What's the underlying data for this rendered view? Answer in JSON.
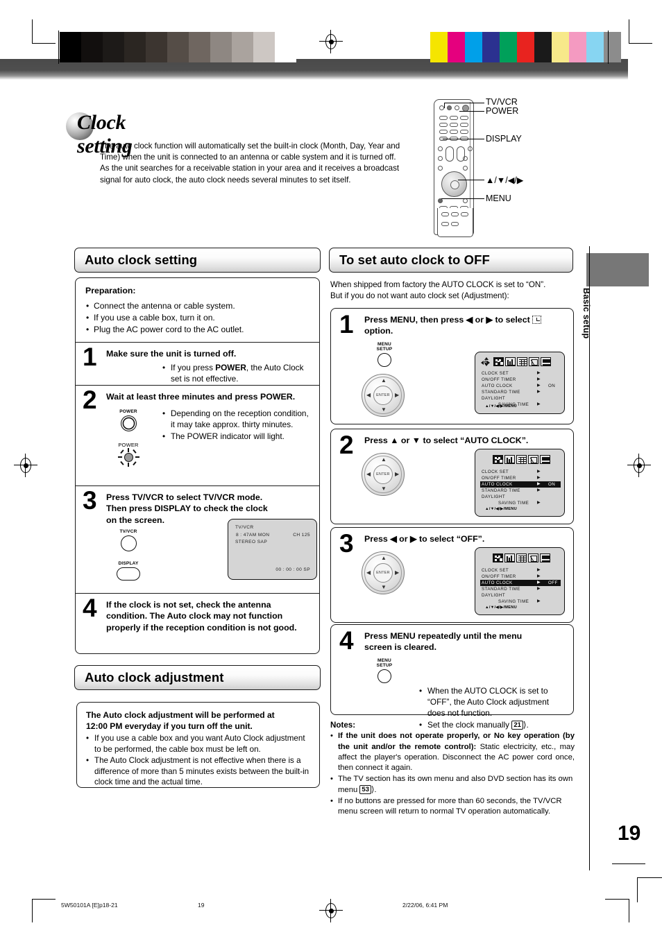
{
  "document": {
    "page_number": "19",
    "side_tab": "Basic setup",
    "title": "Clock setting",
    "intro": "The auto clock function will automatically set the built-in clock (Month, Day, Year and Time) when the unit  is connected to an antenna or cable system and it is turned off. As the unit searches for a receivable station in your area and it receives a broadcast signal for auto clock, the auto clock needs several minutes to set itself."
  },
  "remote_callouts": [
    {
      "label": "TV/VCR"
    },
    {
      "label": "POWER"
    },
    {
      "label": "DISPLAY"
    },
    {
      "label": "▲/▼/◀/▶"
    },
    {
      "label": "MENU"
    }
  ],
  "left_column": {
    "section1_header": "Auto clock setting",
    "preparation": {
      "heading": "Preparation:",
      "items": [
        "Connect the antenna or cable system.",
        "If you use a cable box, turn it on.",
        "Plug the AC power cord to the AC outlet."
      ]
    },
    "steps": [
      {
        "num": "1",
        "title": "Make sure the unit is turned off.",
        "bullets": [
          "If you press POWER, the Auto Clock set is not effective."
        ]
      },
      {
        "num": "2",
        "title": "Wait at least three minutes and press POWER.",
        "bullets": [
          "Depending on the reception condition, it may take approx. thirty minutes.",
          "The POWER indicator will light."
        ],
        "button_caption": "POWER",
        "indicator_caption": "POWER"
      },
      {
        "num": "3",
        "title": "Press TV/VCR to select TV/VCR mode. Then press DISPLAY to check the clock on the screen.",
        "bullets": [],
        "button_caption_1": "TV/VCR",
        "button_caption_2": "DISPLAY",
        "tv_screen": {
          "line1": "TV/VCR",
          "line2_left": "8 : 47AM  MON",
          "line2_right": "CH  125",
          "line3": "STEREO  SAP",
          "line4": "00 : 00 : 00   SP"
        }
      },
      {
        "num": "4",
        "title": "If the clock is not set, check the antenna condition. The Auto clock may not function properly if the reception condition is not good.",
        "bullets": []
      }
    ],
    "section2_header": "Auto clock adjustment",
    "adjustment": {
      "heading_line1": "The Auto clock adjustment will be performed at",
      "heading_line2": "12:00 PM everyday if you turn off the unit.",
      "items": [
        "If you use a cable box and you want Auto Clock adjustment to be performed, the cable box must be left on.",
        "The Auto Clock adjustment is not effective when there is a difference of more than 5 minutes exists between the built-in clock time and the actual time."
      ]
    }
  },
  "right_column": {
    "section_header": "To set auto clock to OFF",
    "intro_line1": "When shipped from factory the AUTO CLOCK is set to “ON”.",
    "intro_line2": "But if you do not want auto clock set (Adjustment):",
    "steps": [
      {
        "num": "1",
        "title_part1": "Press MENU, then press ◀ or ▶ to select",
        "title_part2": "option.",
        "button_caption_line1": "MENU",
        "button_caption_line2": "SETUP"
      },
      {
        "num": "2",
        "title": "Press ▲ or ▼ to select “AUTO CLOCK”."
      },
      {
        "num": "3",
        "title": "Press ◀ or ▶ to select “OFF”."
      },
      {
        "num": "4",
        "title": "Press MENU repeatedly until the menu screen is cleared.",
        "bullets": [
          "When the AUTO CLOCK is set to “OFF”, the Auto Clock adjustment does not function.",
          "Set the clock manually"
        ],
        "page_ref": "21",
        "button_caption_line1": "MENU",
        "button_caption_line2": "SETUP"
      }
    ],
    "osd_screens": [
      {
        "rows": [
          {
            "label": "CLOCK  SET",
            "arrow": "▶",
            "value": "",
            "highlight": false
          },
          {
            "label": "ON/OFF  TIMER",
            "arrow": "▶",
            "value": "",
            "highlight": false
          },
          {
            "label": "AUTO  CLOCK",
            "arrow": "▶",
            "value": "ON",
            "highlight": false
          },
          {
            "label": "STANDARD  TIME",
            "arrow": "▶",
            "value": "",
            "highlight": false
          },
          {
            "label": "DAYLIGHT",
            "arrow": "",
            "value": "",
            "highlight": false
          },
          {
            "label": "SAVING  TIME",
            "arrow": "▶",
            "value": "",
            "highlight": false,
            "indent": true
          }
        ],
        "footer": "▲/▼/◀/▶/MENU",
        "show_nav_icon": true
      },
      {
        "rows": [
          {
            "label": "CLOCK  SET",
            "arrow": "▶",
            "value": "",
            "highlight": false
          },
          {
            "label": "ON/OFF  TIMER",
            "arrow": "▶",
            "value": "",
            "highlight": false
          },
          {
            "label": "AUTO  CLOCK",
            "arrow": "▶",
            "value": "ON",
            "highlight": true
          },
          {
            "label": "STANDARD  TIME",
            "arrow": "▶",
            "value": "",
            "highlight": false
          },
          {
            "label": "DAYLIGHT",
            "arrow": "",
            "value": "",
            "highlight": false
          },
          {
            "label": "SAVING  TIME",
            "arrow": "▶",
            "value": "",
            "highlight": false,
            "indent": true
          }
        ],
        "footer": "▲/▼/◀/▶/MENU",
        "show_nav_icon": false
      },
      {
        "rows": [
          {
            "label": "CLOCK  SET",
            "arrow": "▶",
            "value": "",
            "highlight": false
          },
          {
            "label": "ON/OFF  TIMER",
            "arrow": "▶",
            "value": "",
            "highlight": false
          },
          {
            "label": "AUTO  CLOCK",
            "arrow": "▶",
            "value": "OFF",
            "highlight": true
          },
          {
            "label": "STANDARD  TIME",
            "arrow": "▶",
            "value": "",
            "highlight": false
          },
          {
            "label": "DAYLIGHT",
            "arrow": "",
            "value": "",
            "highlight": false
          },
          {
            "label": "SAVING  TIME",
            "arrow": "▶",
            "value": "",
            "highlight": false,
            "indent": true
          }
        ],
        "footer": "▲/▼/◀/▶/MENU",
        "show_nav_icon": false
      }
    ],
    "dpad_center_label": "ENTER",
    "notes": {
      "heading": "Notes:",
      "items": [
        {
          "bold": "If the unit does not operate properly, or No key operation (by the unit and/or the remote control):",
          "rest": " Static electricity, etc., may affect the player's operation. Disconnect the AC power cord once, then connect it again."
        },
        {
          "bold": "",
          "rest": "The TV section has its own menu and also DVD section has its own menu ",
          "page_ref": "53"
        },
        {
          "bold": "",
          "rest": "If no buttons are pressed for more than 60 seconds, the TV/VCR menu screen will return to normal TV operation automatically."
        }
      ]
    }
  },
  "footer": {
    "file_id": "5W50101A [E]p18-21",
    "page": "19",
    "timestamp": "2/22/06, 6:41 PM"
  },
  "colors": {
    "grayscale_bar": [
      "#000000",
      "#120f0e",
      "#1d1a18",
      "#2b2622",
      "#3c3530",
      "#554d47",
      "#6f6660",
      "#8e8782",
      "#aaa39e",
      "#cdc7c3",
      "#ffffff"
    ],
    "color_bar": [
      "#f5e500",
      "#e5007e",
      "#00a0e9",
      "#2b3190",
      "#00a05a",
      "#e8231f",
      "#1a1a1a",
      "#f7e98a",
      "#f49ac1",
      "#87d5f2",
      "#8c8c8c"
    ],
    "band": "#4a4a4a",
    "side_tab": "#777777"
  }
}
